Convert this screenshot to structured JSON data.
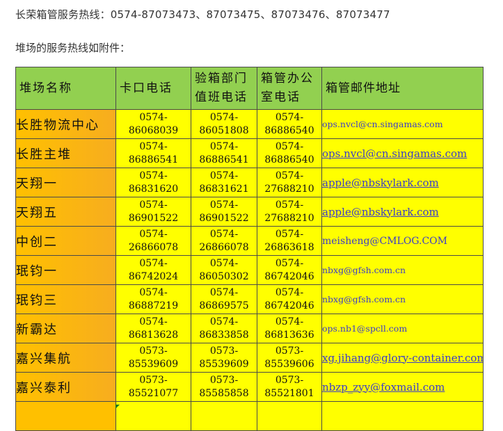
{
  "header": {
    "hotline": "长荣箱管服务热线：0574-87073473、87073475、87073476、87073477",
    "intro": "堆场的服务热线如附件："
  },
  "table": {
    "headers": {
      "name": "堆场名称",
      "gate": "卡口电话",
      "inspect": [
        "验箱部门",
        "值班电话"
      ],
      "office": [
        "箱管办公",
        "室电话"
      ],
      "email": "箱管邮件地址"
    },
    "rows": [
      {
        "name": "长胜物流中心",
        "gate": [
          "0574-",
          "86068039"
        ],
        "inspect": [
          "0574-",
          "86051808"
        ],
        "office": [
          "0574-",
          "86886540"
        ],
        "email": "ops.nvcl@cn.singamas.com"
      },
      {
        "name": "长胜主堆",
        "gate": [
          "0574-",
          "86886541"
        ],
        "inspect": [
          "0574-",
          "86886541"
        ],
        "office": [
          "0574-",
          "86886540"
        ],
        "email": "ops.nvcl@cn.singamas.com"
      },
      {
        "name": "天翔一",
        "gate": [
          "0574-",
          "86831620"
        ],
        "inspect": [
          "0574-",
          "86831621"
        ],
        "office": [
          "0574-",
          "27688210"
        ],
        "email": "apple@nbskylark.com"
      },
      {
        "name": "天翔五",
        "gate": [
          "0574-",
          "86901522"
        ],
        "inspect": [
          "0574-",
          "86901522"
        ],
        "office": [
          "0574-",
          "27688210"
        ],
        "email": "apple@nbskylark.com"
      },
      {
        "name": "中创二",
        "gate": [
          "0574-",
          "26866078"
        ],
        "inspect": [
          "0574-",
          "26866078"
        ],
        "office": [
          "0574-",
          "26863618"
        ],
        "email": "meisheng@CMLOG.COM"
      },
      {
        "name": "珉钧一",
        "gate": [
          "0574-",
          "86742024"
        ],
        "inspect": [
          "0574-",
          "86050302"
        ],
        "office": [
          "0574-",
          "86742046"
        ],
        "email": "nbxg@gfsh.com.cn"
      },
      {
        "name": "珉钧三",
        "gate": [
          "0574-",
          "86887219"
        ],
        "inspect": [
          "0574-",
          "86869575"
        ],
        "office": [
          "0574-",
          "86742046"
        ],
        "email": "nbxg@gfsh.com.cn"
      },
      {
        "name": "新霸达",
        "gate": [
          "0574-",
          "86813628"
        ],
        "inspect": [
          "0574-",
          "86833858"
        ],
        "office": [
          "0574-",
          "86813636"
        ],
        "email": "ops.nb1@spcll.com"
      },
      {
        "name": "嘉兴集航",
        "gate": [
          "0573-",
          "85539609"
        ],
        "inspect": [
          "0573-",
          "85539609"
        ],
        "office": [
          "0573-",
          "85539606"
        ],
        "email": "xg.jihang@glory-container.com"
      },
      {
        "name": "嘉兴泰利",
        "gate": [
          "0573-",
          "85521077"
        ],
        "inspect": [
          "0573-",
          "85585858"
        ],
        "office": [
          "0573-",
          "85521801"
        ],
        "email": "nbzp_zyy@foxmail.com"
      }
    ]
  },
  "colors": {
    "header_bg": "#92d050",
    "name_bg": "#ffc000",
    "cell_bg": "#ffff00",
    "email_text": "#3c3cc8"
  }
}
